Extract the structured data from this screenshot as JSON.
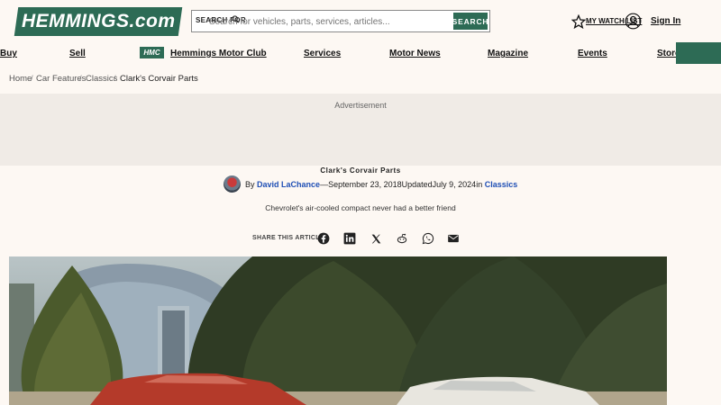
{
  "header": {
    "logo_text": "HEMMINGS.com",
    "search_label": "SEARCH FOR",
    "search_placeholder": "Search for vehicles, parts, services, articles...",
    "search_button": "SEARCH",
    "watch_list": "MY WATCH LIST",
    "sign_in": "Sign In"
  },
  "nav": {
    "items": [
      "Buy",
      "Sell",
      "Hemmings Motor Club",
      "Services",
      "Motor News",
      "Magazine",
      "Events",
      "Store"
    ],
    "club_badge": "HMC"
  },
  "breadcrumb": [
    "Home",
    "Car Features",
    "Classics",
    "Clark's Corvair Parts"
  ],
  "ad": {
    "label": "Advertisement"
  },
  "article": {
    "title": "Clark's Corvair Parts",
    "by": "By",
    "author": "David LaChance",
    "published": "—September 23, 2018",
    "updated_label": "Updated",
    "updated": "July 9, 2024",
    "in_label": "in",
    "category": "Classics",
    "subtitle": "Chevrolet's air-cooled compact never had a better friend",
    "share_label": "SHARE THIS ARTICLE",
    "share_icons": [
      "facebook-icon",
      "linkedin-icon",
      "x-icon",
      "reddit-icon",
      "whatsapp-icon",
      "email-icon"
    ]
  },
  "colors": {
    "brand_green": "#2d6b55",
    "link_blue": "#1f4fb5",
    "page_bg": "#fdf8f3",
    "ad_bg": "#f0ebe6"
  }
}
